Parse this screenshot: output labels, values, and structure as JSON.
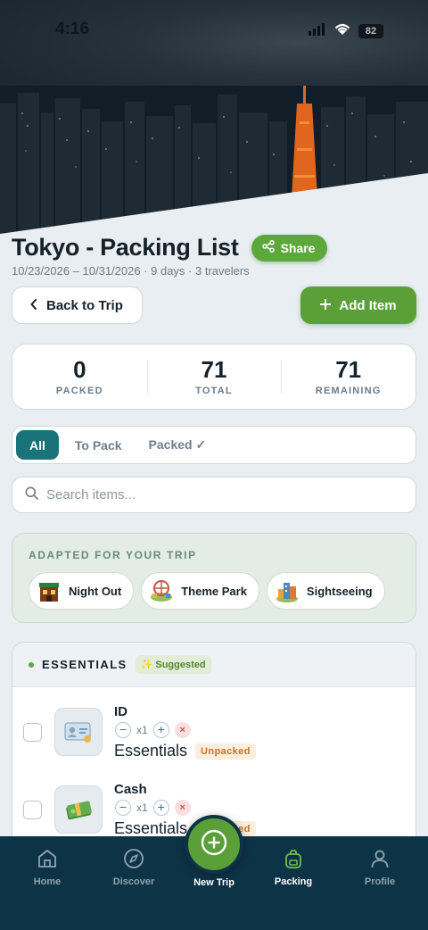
{
  "status_bar": {
    "time": "4:16",
    "battery": "82"
  },
  "header": {
    "title": "Tokyo - Packing List",
    "share_label": "Share",
    "subtitle": "10/23/2026 – 10/31/2026 · 9 days · 3 travelers"
  },
  "actions": {
    "back_label": "Back to Trip",
    "add_label": "Add Item"
  },
  "stats": [
    {
      "value": "0",
      "label": "PACKED"
    },
    {
      "value": "71",
      "label": "TOTAL"
    },
    {
      "value": "71",
      "label": "REMAINING"
    }
  ],
  "tabs": [
    {
      "label": "All",
      "active": true
    },
    {
      "label": "To Pack",
      "active": false
    },
    {
      "label": "Packed ✓",
      "active": false
    }
  ],
  "search": {
    "placeholder": "Search items..."
  },
  "adapted": {
    "heading": "ADAPTED FOR YOUR TRIP",
    "chips": [
      {
        "label": "Night Out",
        "icon": "night-out-icon"
      },
      {
        "label": "Theme Park",
        "icon": "theme-park-icon"
      },
      {
        "label": "Sightseeing",
        "icon": "sightseeing-icon"
      }
    ]
  },
  "section": {
    "name": "ESSENTIALS",
    "badge": "✨ Suggested",
    "items": [
      {
        "name": "ID",
        "qty": "x1",
        "category": "Essentials",
        "status": "Unpacked",
        "icon": "id-card-icon"
      },
      {
        "name": "Cash",
        "qty": "x1",
        "category": "Essentials",
        "status": "Unpacked",
        "icon": "cash-icon"
      }
    ]
  },
  "nav": {
    "home": "Home",
    "discover": "Discover",
    "new_trip": "New Trip",
    "packing": "Packing",
    "profile": "Profile"
  },
  "colors": {
    "accent_green": "#5a9f37",
    "teal": "#1a7378",
    "nav_bg": "#0d3347"
  }
}
